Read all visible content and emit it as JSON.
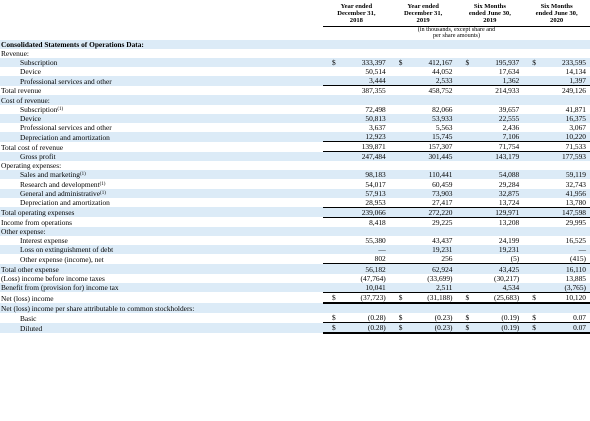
{
  "columns": [
    {
      "line1": "Year ended",
      "line2": "December 31,",
      "line3": "2018"
    },
    {
      "line1": "Year ended",
      "line2": "December 31,",
      "line3": "2019"
    },
    {
      "line1": "Six Months",
      "line2": "ended June 30,",
      "line3": "2019"
    },
    {
      "line1": "Six Months",
      "line2": "ended June 30,",
      "line3": "2020"
    }
  ],
  "units_note_line1": "(in thousands, except share and",
  "units_note_line2": "per share amounts)",
  "rows": [
    {
      "label": "Consolidated Statements of Operations Data:",
      "bold": true,
      "indent": 0,
      "values": [
        "",
        "",
        "",
        ""
      ],
      "shade": true
    },
    {
      "label": "Revenue:",
      "indent": 0,
      "values": [
        "",
        "",
        "",
        ""
      ],
      "shade": false
    },
    {
      "label": "Subscription",
      "indent": 1,
      "cur": true,
      "values": [
        "333,397",
        "412,167",
        "195,937",
        "233,595"
      ],
      "shade": true
    },
    {
      "label": "Device",
      "indent": 1,
      "values": [
        "50,514",
        "44,052",
        "17,634",
        "14,134"
      ],
      "shade": false
    },
    {
      "label": "Professional services and other",
      "indent": 1,
      "values": [
        "3,444",
        "2,533",
        "1,362",
        "1,397"
      ],
      "shade": true
    },
    {
      "label": "Total revenue",
      "indent": 0,
      "top": true,
      "values": [
        "387,355",
        "458,752",
        "214,933",
        "249,126"
      ],
      "shade": false
    },
    {
      "label": "Cost of revenue:",
      "indent": 0,
      "values": [
        "",
        "",
        "",
        ""
      ],
      "shade": true
    },
    {
      "label": "Subscription",
      "sup": "(1)",
      "indent": 1,
      "values": [
        "72,498",
        "82,066",
        "39,657",
        "41,871"
      ],
      "shade": false
    },
    {
      "label": "Device",
      "indent": 1,
      "values": [
        "50,813",
        "53,933",
        "22,555",
        "16,375"
      ],
      "shade": true
    },
    {
      "label": "Professional services and other",
      "indent": 1,
      "values": [
        "3,637",
        "5,563",
        "2,436",
        "3,067"
      ],
      "shade": false
    },
    {
      "label": "Depreciation and amortization",
      "indent": 1,
      "values": [
        "12,923",
        "15,745",
        "7,106",
        "10,220"
      ],
      "shade": true
    },
    {
      "label": "Total cost of revenue",
      "indent": 0,
      "top": true,
      "values": [
        "139,871",
        "157,307",
        "71,754",
        "71,533"
      ],
      "shade": false
    },
    {
      "label": "Gross profit",
      "indent": 1,
      "top": true,
      "values": [
        "247,484",
        "301,445",
        "143,179",
        "177,593"
      ],
      "shade": true
    },
    {
      "label": "Operating expenses:",
      "indent": 0,
      "values": [
        "",
        "",
        "",
        ""
      ],
      "shade": false
    },
    {
      "label": "Sales and marketing",
      "sup": "(1)",
      "indent": 1,
      "values": [
        "98,183",
        "110,441",
        "54,088",
        "59,119"
      ],
      "shade": true
    },
    {
      "label": "Research and development",
      "sup": "(1)",
      "indent": 1,
      "values": [
        "54,017",
        "60,459",
        "29,284",
        "32,743"
      ],
      "shade": false
    },
    {
      "label": "General and administrative",
      "sup": "(1)",
      "indent": 1,
      "values": [
        "57,913",
        "73,903",
        "32,875",
        "41,956"
      ],
      "shade": true
    },
    {
      "label": "Depreciation and amortization",
      "indent": 1,
      "values": [
        "28,953",
        "27,417",
        "13,724",
        "13,780"
      ],
      "shade": false
    },
    {
      "label": "Total operating expenses",
      "indent": 0,
      "top": true,
      "values": [
        "239,066",
        "272,220",
        "129,971",
        "147,598"
      ],
      "shade": true
    },
    {
      "label": "Income from operations",
      "indent": 0,
      "top": true,
      "values": [
        "8,418",
        "29,225",
        "13,208",
        "29,995"
      ],
      "shade": false
    },
    {
      "label": "Other expense:",
      "indent": 0,
      "values": [
        "",
        "",
        "",
        ""
      ],
      "shade": true
    },
    {
      "label": "Interest expense",
      "indent": 1,
      "values": [
        "55,380",
        "43,437",
        "24,199",
        "16,525"
      ],
      "shade": false
    },
    {
      "label": "Loss on extinguishment of debt",
      "indent": 1,
      "values": [
        "—",
        "19,231",
        "19,231",
        "—"
      ],
      "shade": true
    },
    {
      "label": "Other expense (income), net",
      "indent": 1,
      "values": [
        "802",
        "256",
        "(5)",
        "(415)"
      ],
      "shade": false
    },
    {
      "label": "Total other expense",
      "indent": 0,
      "top": true,
      "values": [
        "56,182",
        "62,924",
        "43,425",
        "16,110"
      ],
      "shade": true
    },
    {
      "label": "(Loss) income before income taxes",
      "indent": 0,
      "values": [
        "(47,764)",
        "(33,699)",
        "(30,217)",
        "13,885"
      ],
      "shade": false
    },
    {
      "label": "Benefit from (provision for) income tax",
      "indent": 0,
      "values": [
        "10,041",
        "2,511",
        "4,534",
        "(3,765)"
      ],
      "shade": true
    },
    {
      "label": "Net (loss) income",
      "indent": 0,
      "top": true,
      "dbl": true,
      "cur": true,
      "values": [
        "(37,723)",
        "(31,188)",
        "(25,683)",
        "10,120"
      ],
      "shade": false
    },
    {
      "label": "Net (loss) income per share attributable to common stockholders:",
      "indent": 0,
      "values": [
        "",
        "",
        "",
        ""
      ],
      "shade": true
    },
    {
      "label": "Basic",
      "indent": 1,
      "cur": true,
      "values": [
        "(0.28)",
        "(0.23)",
        "(0.19)",
        "0.07"
      ],
      "shade": false
    },
    {
      "label": "Diluted",
      "indent": 1,
      "cur": true,
      "top": true,
      "dbl": true,
      "values": [
        "(0.28)",
        "(0.23)",
        "(0.19)",
        "0.07"
      ],
      "shade": true
    }
  ],
  "currency_symbol": "$"
}
